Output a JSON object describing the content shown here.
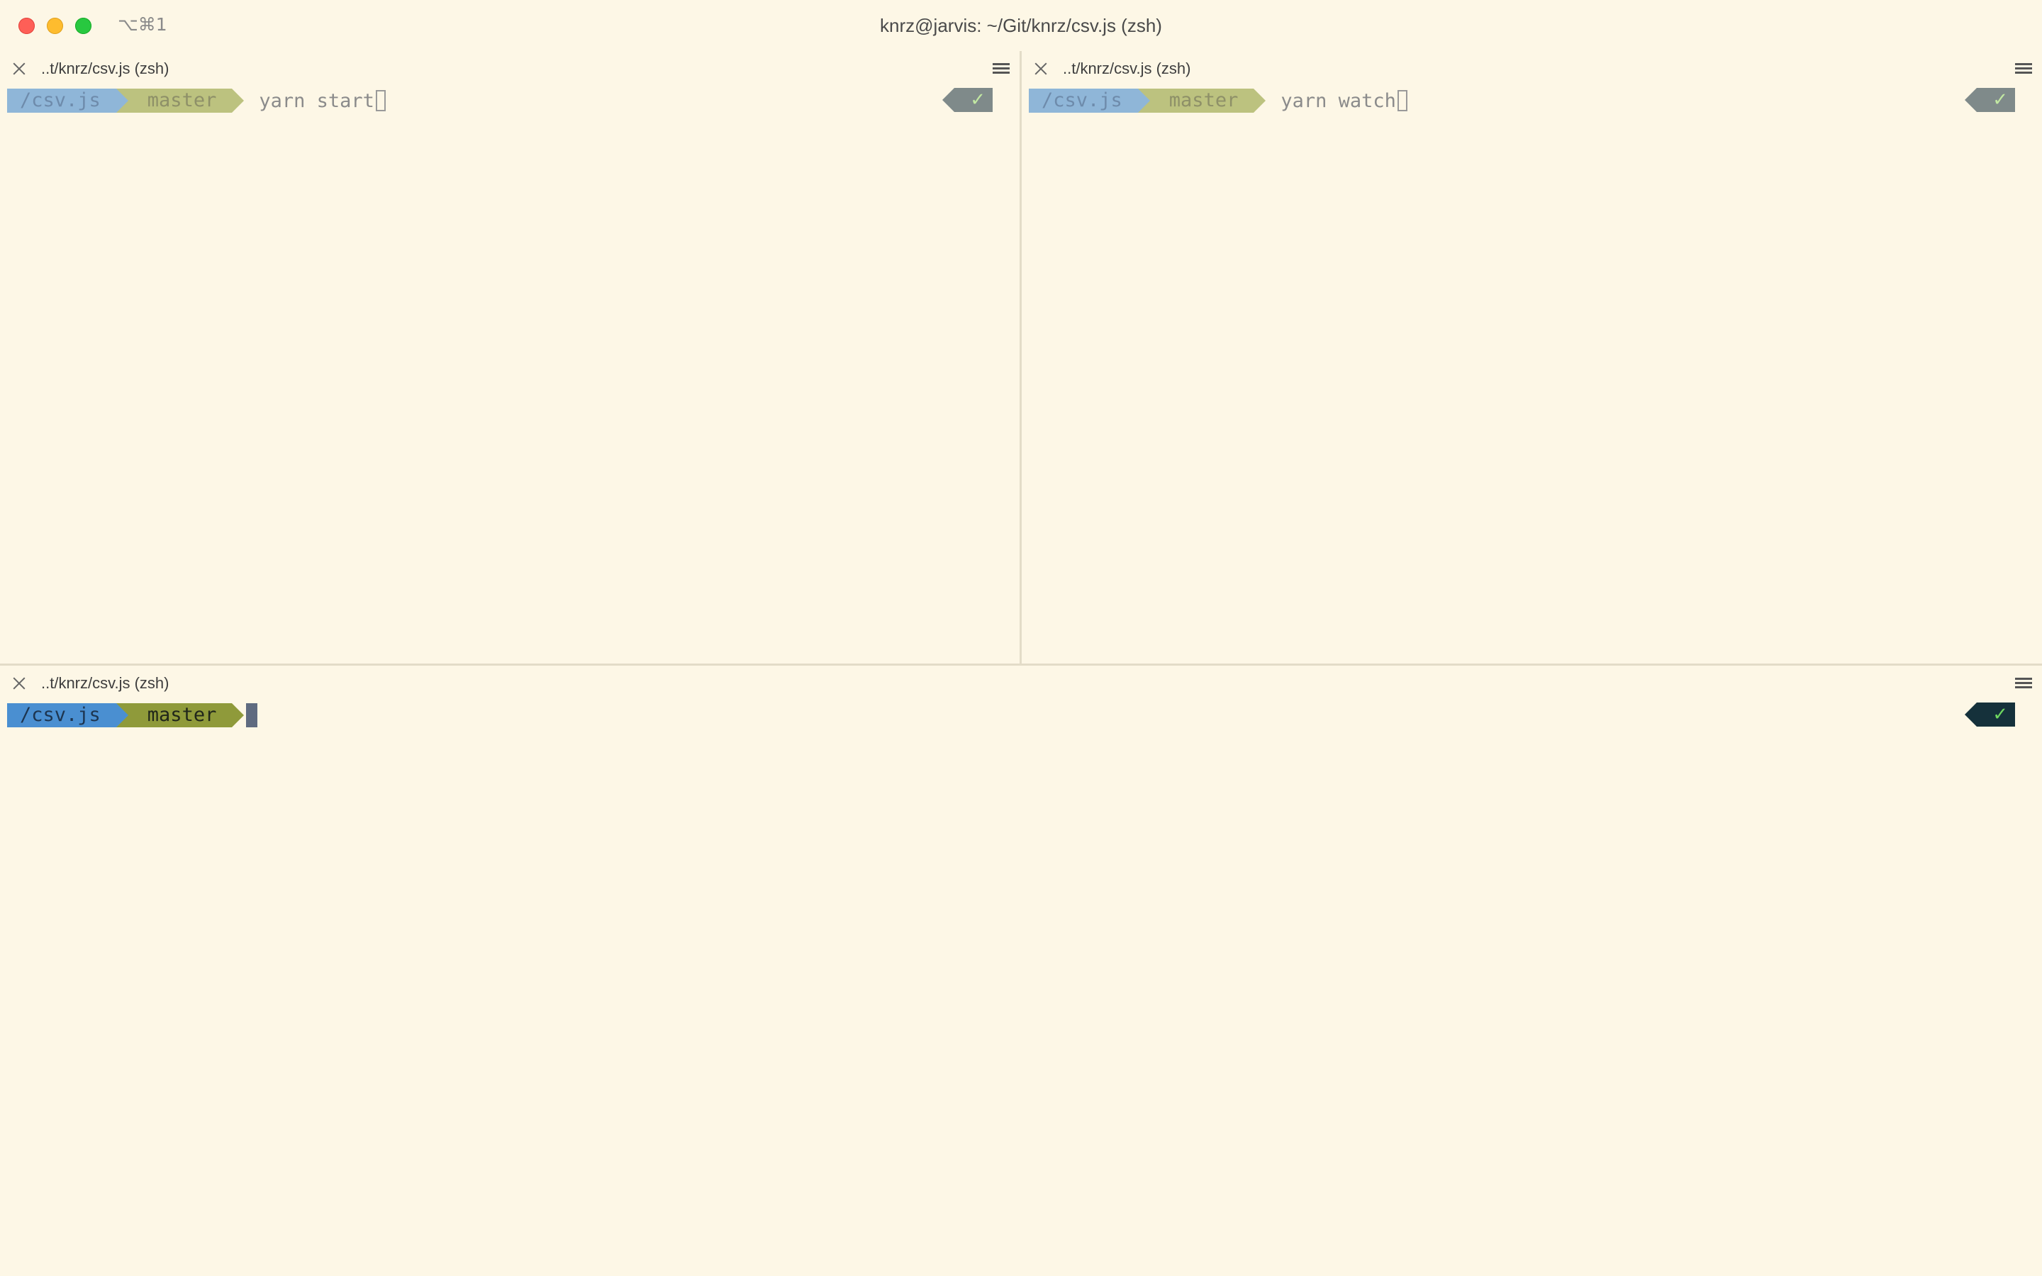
{
  "window": {
    "title": "knrz@jarvis: ~/Git/knrz/csv.js (zsh)",
    "shortcut": "⌥⌘1"
  },
  "panes": {
    "top_left": {
      "title": "..t/knrz/csv.js (zsh)",
      "dir": "/csv.js",
      "branch_icon": "",
      "branch": "master",
      "command": "yarn start",
      "status": "✓"
    },
    "top_right": {
      "title": "..t/knrz/csv.js (zsh)",
      "dir": "/csv.js",
      "branch_icon": "",
      "branch": "master",
      "command": "yarn watch",
      "status": "✓"
    },
    "bottom": {
      "title": "..t/knrz/csv.js (zsh)",
      "dir": "/csv.js",
      "branch_icon": "",
      "branch": "master",
      "command": "",
      "status": "✓"
    }
  },
  "icons": {
    "close": "close-icon",
    "menu": "hamburger-menu-icon",
    "branch": "git-branch-icon",
    "status": "check-icon"
  },
  "colors": {
    "background": "#fdf7e6",
    "dir_segment": "#4a8fd1",
    "git_segment": "#8f9a3a",
    "status_active": "#15313b",
    "traffic_close": "#fe5f57",
    "traffic_minimize": "#febc2e",
    "traffic_maximize": "#28c840"
  }
}
